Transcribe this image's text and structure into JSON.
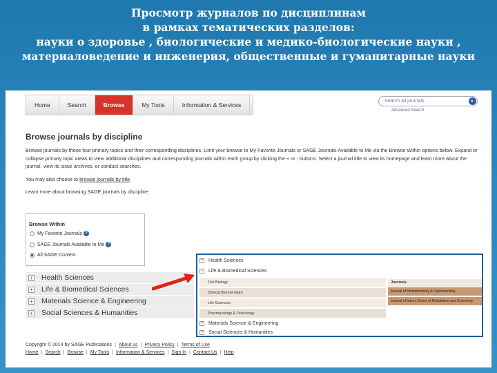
{
  "slide": {
    "title_lines": [
      "Просмотр журналов по дисциплинам",
      "в рамках тематических разделов:",
      "науки о здоровье , биологические и медико-биологические науки ,",
      "материаловедение и инженерия, общественные и гуманитарные науки"
    ]
  },
  "nav": {
    "items": [
      "Home",
      "Search",
      "Browse",
      "My Tools",
      "Information & Services"
    ],
    "active": "Browse"
  },
  "search": {
    "placeholder": "Search all journals",
    "advanced_label": "Advanced Search"
  },
  "main": {
    "title": "Browse journals by discipline",
    "description": "Browse journals by these four primary topics and their corresponding disciplines. Limit your browse to My Favorite Journals or SAGE Journals Available to Me via the Browse Within options below. Expand or collapse primary topic areas to view additional disciplines and corresponding journals within each group by clicking the + or - buttons. Select a journal title to view its homepage and learn more about the journal, view its issue archives, or conduct searches.",
    "also_prefix": "You may also choose to ",
    "also_link": "browse journals by title",
    "also_suffix": ".",
    "learn_more": "Learn more about browsing SAGE journals by discipline"
  },
  "browse_within": {
    "title": "Browse Within",
    "options": [
      {
        "label": "My Favorite Journals",
        "selected": false
      },
      {
        "label": "SAGE Journals Available to Me",
        "selected": false
      },
      {
        "label": "All SAGE Content",
        "selected": true
      }
    ]
  },
  "disciplines": [
    "Health Sciences",
    "Life & Biomedical Sciences",
    "Materials Science & Engineering",
    "Social Sciences & Humanities"
  ],
  "zoom": {
    "top_items": [
      "Health Sciences",
      "Life & Biomedical Sciences"
    ],
    "sub_items": [
      "Cell Biology",
      "Clinical Biochemistry",
      "Life Sciences",
      "Pharmacology & Toxicology"
    ],
    "bottom_items": [
      "Materials Science & Engineering",
      "Social Sciences & Humanities"
    ],
    "journals_header": "Journals",
    "journals": [
      "Journal of Histochemistry & Cytochemistry",
      "Journal of Inborn Errors of Metabolism and Screening"
    ]
  },
  "footer": {
    "copyright": "Copyright © 2014 by SAGE Publications",
    "copyright_links": [
      "About us",
      "Privacy Policy",
      "Terms of Use"
    ],
    "links": [
      "Home",
      "Search",
      "Browse",
      "My Tools",
      "Information & Services",
      "Sign In",
      "Contact Us",
      "Help"
    ]
  },
  "colors": {
    "accent": "#d6332a",
    "background": "#2a86bd",
    "journal_highlight": "#c99770"
  }
}
